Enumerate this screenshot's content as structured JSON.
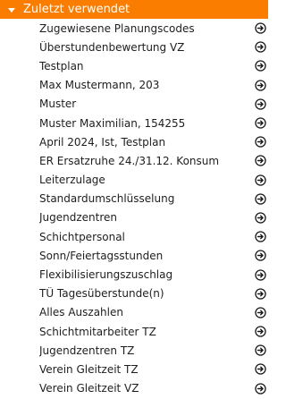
{
  "section": {
    "title": "Zuletzt verwendet",
    "accent_color": "#fa7d00"
  },
  "items": [
    {
      "label": "Zugewiesene Planungscodes"
    },
    {
      "label": "Überstundenbewertung VZ"
    },
    {
      "label": "Testplan"
    },
    {
      "label": "Max Mustermann, 203"
    },
    {
      "label": "Muster"
    },
    {
      "label": "Muster Maximilian, 154255"
    },
    {
      "label": "April 2024, Ist, Testplan"
    },
    {
      "label": "ER Ersatzruhe 24./31.12. Konsum"
    },
    {
      "label": "Leiterzulage"
    },
    {
      "label": "Standardumschlüsselung"
    },
    {
      "label": "Jugendzentren"
    },
    {
      "label": "Schichtpersonal"
    },
    {
      "label": "Sonn/Feiertagsstunden"
    },
    {
      "label": "Flexibilisierungszuschlag"
    },
    {
      "label": "TÜ Tagesüberstunde(n)"
    },
    {
      "label": "Alles Auszahlen"
    },
    {
      "label": "Schichtmitarbeiter TZ"
    },
    {
      "label": "Jugendzentren TZ"
    },
    {
      "label": "Verein Gleitzeit TZ"
    },
    {
      "label": "Verein Gleitzeit VZ"
    }
  ],
  "item_icon": "arrow-right-circle-icon"
}
